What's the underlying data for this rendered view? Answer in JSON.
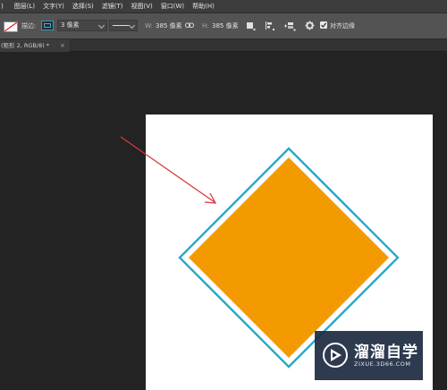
{
  "menu": {
    "items": [
      {
        "label": ")"
      },
      {
        "label": "图层(L)"
      },
      {
        "label": "文字(Y)"
      },
      {
        "label": "选择(S)"
      },
      {
        "label": "滤镜(T)"
      },
      {
        "label": "视图(V)"
      },
      {
        "label": "窗口(W)"
      },
      {
        "label": "帮助(H)"
      }
    ]
  },
  "options": {
    "stroke_label": "描边:",
    "stroke_width_value": "3 像素",
    "width_label": "W:",
    "width_value": "385 像素",
    "height_label": "H:",
    "height_value": "385 像素",
    "align_edges_label": "对齐边缘",
    "align_edges_checked": true
  },
  "document_tab": {
    "title": "(矩形 2, RGB/8) *",
    "close_glyph": "×"
  },
  "canvas": {
    "shape_fill_color": "#f39a00",
    "shape_stroke_color": "#2aa8c9",
    "arrow_color": "#d9363b"
  },
  "watermark": {
    "title": "溜溜自学",
    "url": "ZIXUE.3D66.COM"
  }
}
